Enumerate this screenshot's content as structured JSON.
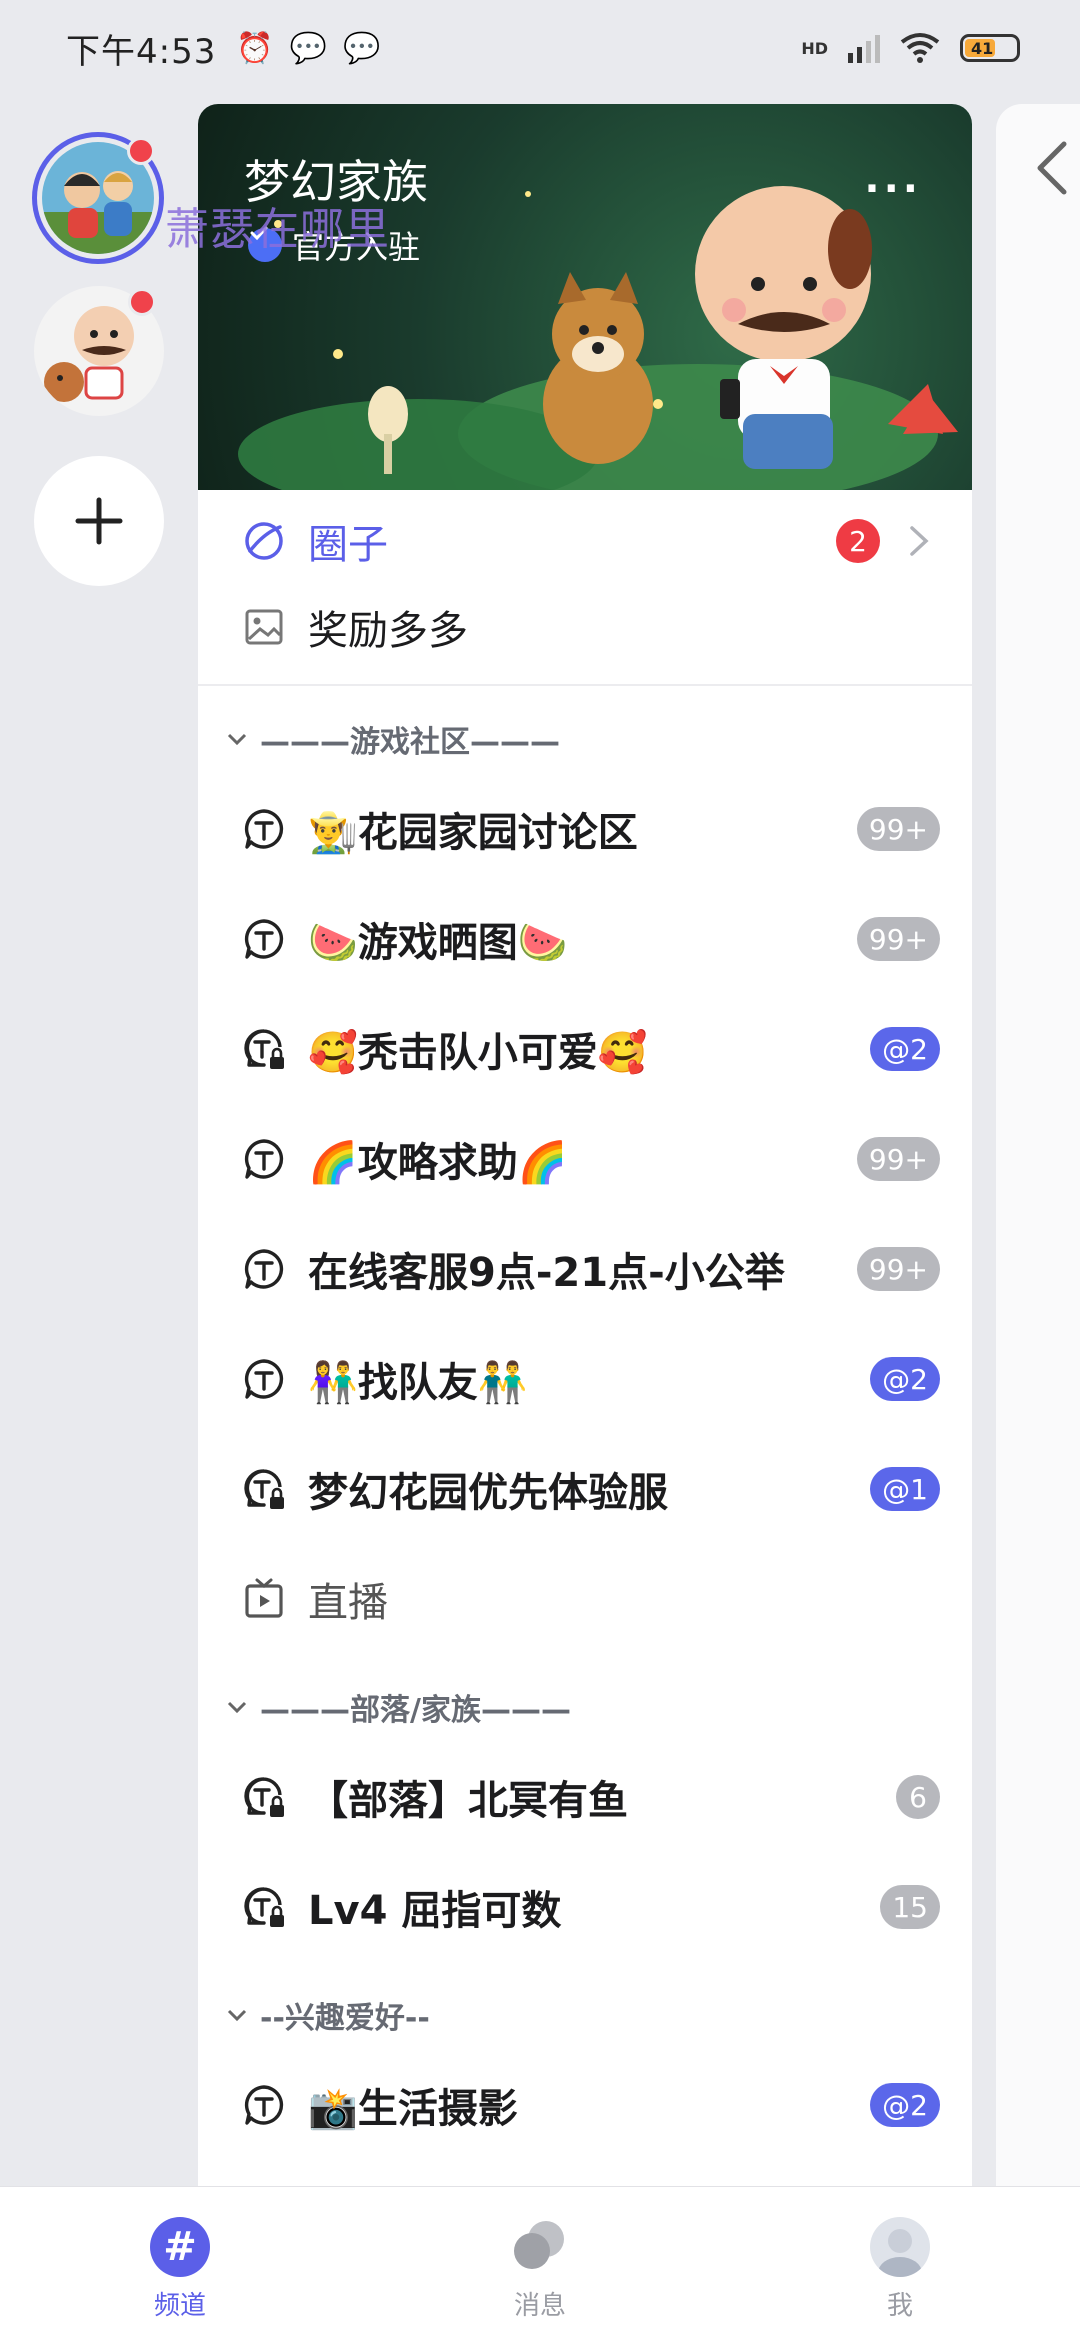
{
  "status_bar": {
    "time": "下午4:53",
    "network": "HD",
    "battery": "41"
  },
  "watermark": "萧瑟在哪里",
  "guild": {
    "title": "梦幻家族",
    "official": "官方入驻",
    "more": "···"
  },
  "features": [
    {
      "label": "圈子",
      "badge": "2"
    },
    {
      "label": "奖励多多"
    }
  ],
  "sections": [
    {
      "title": "———游戏社区———",
      "channels": [
        {
          "name": "👨‍🌾花园家园讨论区",
          "badge": "99+",
          "badge_type": "gray",
          "icon": "topic-icon"
        },
        {
          "name": "🍉游戏晒图🍉",
          "badge": "99+",
          "badge_type": "gray",
          "icon": "topic-icon"
        },
        {
          "name": "🥰秃击队小可爱🥰",
          "badge": "@2",
          "badge_type": "blue",
          "icon": "private-topic-icon"
        },
        {
          "name": "🌈攻略求助🌈",
          "badge": "99+",
          "badge_type": "gray",
          "icon": "topic-icon"
        },
        {
          "name": "在线客服9点-21点-小公举",
          "badge": "99+",
          "badge_type": "gray",
          "icon": "topic-icon"
        },
        {
          "name": "👫找队友👬",
          "badge": "@2",
          "badge_type": "blue",
          "icon": "topic-icon"
        },
        {
          "name": "梦幻花园优先体验服",
          "badge": "@1",
          "badge_type": "blue",
          "icon": "private-topic-icon"
        },
        {
          "name": "直播",
          "badge": "",
          "badge_type": "",
          "icon": "live-icon"
        }
      ]
    },
    {
      "title": "———部落/家族———",
      "channels": [
        {
          "name": "【部落】北冥有鱼",
          "badge": "6",
          "badge_type": "gray",
          "icon": "private-topic-icon"
        },
        {
          "name": "Lv4 屈指可数",
          "badge": "15",
          "badge_type": "gray",
          "icon": "private-topic-icon"
        }
      ]
    },
    {
      "title": "--兴趣爱好--",
      "channels": [
        {
          "name": "📸生活摄影",
          "badge": "@2",
          "badge_type": "blue",
          "icon": "topic-icon"
        }
      ]
    }
  ],
  "nav": [
    {
      "label": "频道",
      "active": true
    },
    {
      "label": "消息",
      "active": false
    },
    {
      "label": "我",
      "active": false
    }
  ],
  "colors": {
    "accent": "#5b5fe8",
    "badge_red": "#ef3b44",
    "badge_gray": "#b7b8bd",
    "badge_blue": "#5b67ea"
  }
}
